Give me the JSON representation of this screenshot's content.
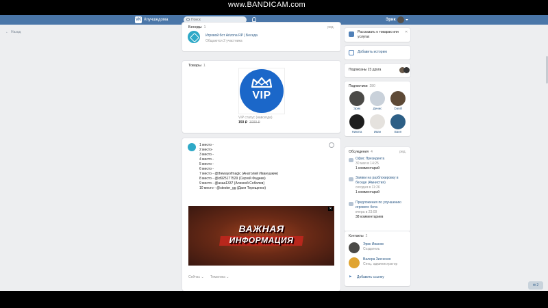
{
  "topbar": {
    "logo": "VK",
    "hashtag": "#лучшедома",
    "search_placeholder": "Поиск",
    "user_name": "Эрик",
    "bg_color": "#4a76a8"
  },
  "watermark": {
    "prefix": "www.",
    "brand": "BANDICAM",
    "suffix": ".com"
  },
  "back_link": "Назад",
  "conversations": {
    "title": "Беседы",
    "count": "1",
    "right": "ред.",
    "item_title": "Игровой бот Arizona RP | Беседа",
    "item_sub": "Общаются 2 участника"
  },
  "products": {
    "title": "Товары",
    "count": "1",
    "item_name": "VIP статус (навсегда)",
    "price": "150 ₽",
    "old_price": "1000 ₽",
    "vip_label": "VIP"
  },
  "post": {
    "lines": [
      "1 место -",
      "2 место-",
      "3 место -",
      "4 место -",
      "5 место -",
      "6 место -",
      "7 место - @thewayofmagic (Анатолий Иванушкин)",
      "8 место - @id925177529 (Сергей Фадеев)",
      "9 место - @asaa1337 (Алексей Соболев)",
      "10 место - @stester_gg (Даня Терещенко)"
    ],
    "banner_line1": "ВАЖНАЯ",
    "banner_line2": "ИНФОРМАЦИЯ",
    "close": "✕",
    "footer_left": "Сейчас ⌄",
    "footer_right": "Тематика ⌄"
  },
  "right": {
    "notify_text": "Рассказать о товарах или услугах",
    "add_story": "Добавить историю",
    "subscribed": "Подписаны 23 друга",
    "followers_title": "Подписчики",
    "followers_count": "280",
    "friends": [
      {
        "name": "Эрик",
        "color": "#4b4a47"
      },
      {
        "name": "Денис",
        "color": "#c9d1da"
      },
      {
        "name": "Danill",
        "color": "#5e4a37"
      },
      {
        "name": "Никита",
        "color": "#1e1e1e"
      },
      {
        "name": "Иван",
        "color": "#e5e2de"
      },
      {
        "name": "Ваня",
        "color": "#2d5f86"
      }
    ],
    "discussions_title": "Обсуждения",
    "discussions_count": "4",
    "discussions_right": "ред.",
    "discussions": [
      {
        "title": "Офис Президента",
        "date": "30 мая в 14:25",
        "comments": "1 комментарий"
      },
      {
        "title": "Заявки на разблокировку в беседе (Амнистия)",
        "date": "сегодня в 11:26",
        "comments": "1 комментарий"
      },
      {
        "title": "Предложения по улучшению игрового бота",
        "date": "вчера в 23:09",
        "comments": "38 комментариев"
      }
    ],
    "contacts_title": "Контакты",
    "contacts_count": "2",
    "contacts": [
      {
        "name": "Эрик Иванов",
        "role": "Создатель",
        "color": "#4b4a47"
      },
      {
        "name": "Валера Зинченко",
        "role": "Спец. администратор",
        "color": "#e0a431"
      }
    ],
    "add_link": "Добавить ссылку"
  },
  "chat_button": "✉ 2"
}
